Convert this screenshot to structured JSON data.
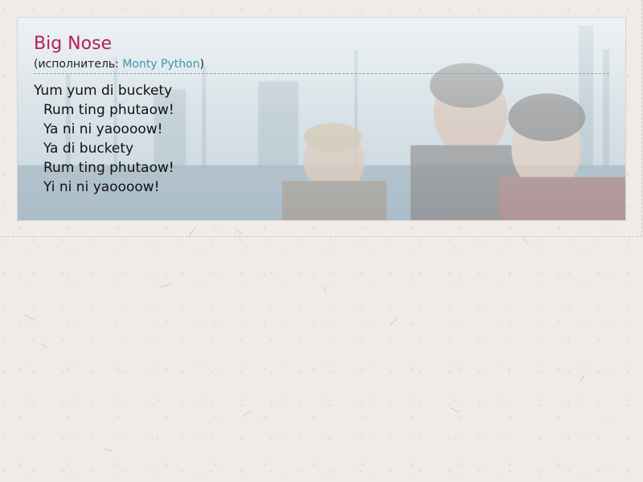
{
  "song": {
    "title": "Big Nose",
    "artist_prefix": "(исполнитель: ",
    "artist_name": "Monty Python",
    "artist_suffix": ")"
  },
  "lyrics": [
    "Yum yum di buckety",
    "Rum ting phutaow!",
    "Ya ni ni yaoooow!",
    "Ya di buckety",
    "Rum ting phutaow!",
    "Yi ni ni yaoooow!"
  ],
  "colors": {
    "title": "#b5214f",
    "link": "#3a97ad",
    "page_background": "#f0ebe7"
  }
}
